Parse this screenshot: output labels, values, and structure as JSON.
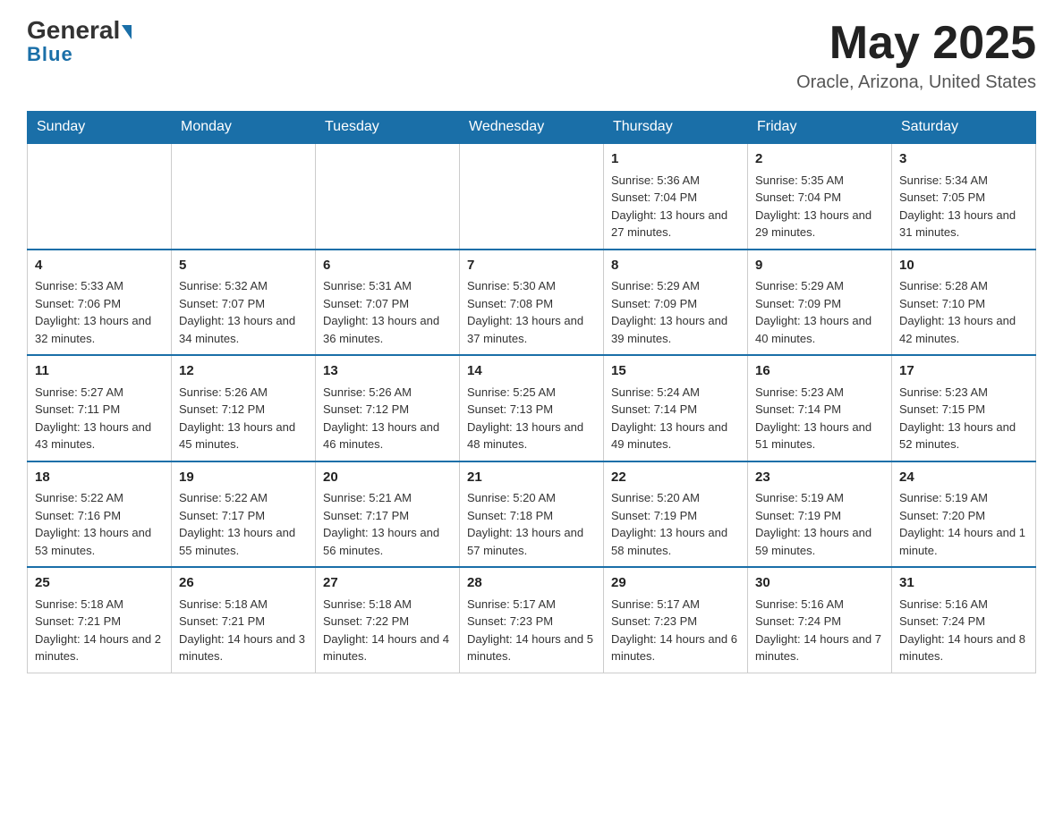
{
  "header": {
    "logo_general": "General",
    "logo_blue": "Blue",
    "month": "May 2025",
    "location": "Oracle, Arizona, United States"
  },
  "days_of_week": [
    "Sunday",
    "Monday",
    "Tuesday",
    "Wednesday",
    "Thursday",
    "Friday",
    "Saturday"
  ],
  "weeks": [
    [
      {
        "day": "",
        "info": ""
      },
      {
        "day": "",
        "info": ""
      },
      {
        "day": "",
        "info": ""
      },
      {
        "day": "",
        "info": ""
      },
      {
        "day": "1",
        "info": "Sunrise: 5:36 AM\nSunset: 7:04 PM\nDaylight: 13 hours and 27 minutes."
      },
      {
        "day": "2",
        "info": "Sunrise: 5:35 AM\nSunset: 7:04 PM\nDaylight: 13 hours and 29 minutes."
      },
      {
        "day": "3",
        "info": "Sunrise: 5:34 AM\nSunset: 7:05 PM\nDaylight: 13 hours and 31 minutes."
      }
    ],
    [
      {
        "day": "4",
        "info": "Sunrise: 5:33 AM\nSunset: 7:06 PM\nDaylight: 13 hours and 32 minutes."
      },
      {
        "day": "5",
        "info": "Sunrise: 5:32 AM\nSunset: 7:07 PM\nDaylight: 13 hours and 34 minutes."
      },
      {
        "day": "6",
        "info": "Sunrise: 5:31 AM\nSunset: 7:07 PM\nDaylight: 13 hours and 36 minutes."
      },
      {
        "day": "7",
        "info": "Sunrise: 5:30 AM\nSunset: 7:08 PM\nDaylight: 13 hours and 37 minutes."
      },
      {
        "day": "8",
        "info": "Sunrise: 5:29 AM\nSunset: 7:09 PM\nDaylight: 13 hours and 39 minutes."
      },
      {
        "day": "9",
        "info": "Sunrise: 5:29 AM\nSunset: 7:09 PM\nDaylight: 13 hours and 40 minutes."
      },
      {
        "day": "10",
        "info": "Sunrise: 5:28 AM\nSunset: 7:10 PM\nDaylight: 13 hours and 42 minutes."
      }
    ],
    [
      {
        "day": "11",
        "info": "Sunrise: 5:27 AM\nSunset: 7:11 PM\nDaylight: 13 hours and 43 minutes."
      },
      {
        "day": "12",
        "info": "Sunrise: 5:26 AM\nSunset: 7:12 PM\nDaylight: 13 hours and 45 minutes."
      },
      {
        "day": "13",
        "info": "Sunrise: 5:26 AM\nSunset: 7:12 PM\nDaylight: 13 hours and 46 minutes."
      },
      {
        "day": "14",
        "info": "Sunrise: 5:25 AM\nSunset: 7:13 PM\nDaylight: 13 hours and 48 minutes."
      },
      {
        "day": "15",
        "info": "Sunrise: 5:24 AM\nSunset: 7:14 PM\nDaylight: 13 hours and 49 minutes."
      },
      {
        "day": "16",
        "info": "Sunrise: 5:23 AM\nSunset: 7:14 PM\nDaylight: 13 hours and 51 minutes."
      },
      {
        "day": "17",
        "info": "Sunrise: 5:23 AM\nSunset: 7:15 PM\nDaylight: 13 hours and 52 minutes."
      }
    ],
    [
      {
        "day": "18",
        "info": "Sunrise: 5:22 AM\nSunset: 7:16 PM\nDaylight: 13 hours and 53 minutes."
      },
      {
        "day": "19",
        "info": "Sunrise: 5:22 AM\nSunset: 7:17 PM\nDaylight: 13 hours and 55 minutes."
      },
      {
        "day": "20",
        "info": "Sunrise: 5:21 AM\nSunset: 7:17 PM\nDaylight: 13 hours and 56 minutes."
      },
      {
        "day": "21",
        "info": "Sunrise: 5:20 AM\nSunset: 7:18 PM\nDaylight: 13 hours and 57 minutes."
      },
      {
        "day": "22",
        "info": "Sunrise: 5:20 AM\nSunset: 7:19 PM\nDaylight: 13 hours and 58 minutes."
      },
      {
        "day": "23",
        "info": "Sunrise: 5:19 AM\nSunset: 7:19 PM\nDaylight: 13 hours and 59 minutes."
      },
      {
        "day": "24",
        "info": "Sunrise: 5:19 AM\nSunset: 7:20 PM\nDaylight: 14 hours and 1 minute."
      }
    ],
    [
      {
        "day": "25",
        "info": "Sunrise: 5:18 AM\nSunset: 7:21 PM\nDaylight: 14 hours and 2 minutes."
      },
      {
        "day": "26",
        "info": "Sunrise: 5:18 AM\nSunset: 7:21 PM\nDaylight: 14 hours and 3 minutes."
      },
      {
        "day": "27",
        "info": "Sunrise: 5:18 AM\nSunset: 7:22 PM\nDaylight: 14 hours and 4 minutes."
      },
      {
        "day": "28",
        "info": "Sunrise: 5:17 AM\nSunset: 7:23 PM\nDaylight: 14 hours and 5 minutes."
      },
      {
        "day": "29",
        "info": "Sunrise: 5:17 AM\nSunset: 7:23 PM\nDaylight: 14 hours and 6 minutes."
      },
      {
        "day": "30",
        "info": "Sunrise: 5:16 AM\nSunset: 7:24 PM\nDaylight: 14 hours and 7 minutes."
      },
      {
        "day": "31",
        "info": "Sunrise: 5:16 AM\nSunset: 7:24 PM\nDaylight: 14 hours and 8 minutes."
      }
    ]
  ]
}
